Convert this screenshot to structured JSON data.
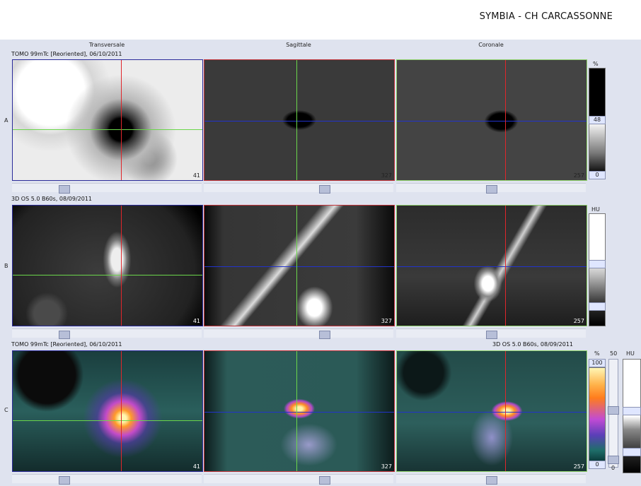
{
  "header": {
    "site": "SYMBIA - CH CARCASSONNE"
  },
  "columns": [
    "Transversale",
    "Sagittale",
    "Coronale"
  ],
  "rows": {
    "A": {
      "label": "A",
      "series": "TOMO 99mTc [Reoriented], 06/10/2011"
    },
    "B": {
      "label": "B",
      "series": "3D  OS  5.0  B60s, 08/09/2011"
    },
    "C": {
      "label": "C",
      "series_left": "TOMO 99mTc [Reoriented], 06/10/2011",
      "series_right": "3D  OS  5.0  B60s, 08/09/2011"
    }
  },
  "slices": {
    "transversale": "41",
    "sagittale": "327",
    "coronale": "257"
  },
  "scales": {
    "A": {
      "unit": "%",
      "mid": "48",
      "min": "0"
    },
    "B": {
      "unit": "HU"
    },
    "C": {
      "unit_pct": "%",
      "top_pct": "100",
      "min_pct": "0",
      "unit_mid": "50",
      "unit_hu": "HU",
      "hu_min": "0"
    }
  },
  "colors": {
    "transversale": "#2b2b9a",
    "sagittale": "#c2343a",
    "coronale": "#8fd16b",
    "crosshair_h_green": "#6bd64b",
    "crosshair_v_red": "#e0262b",
    "crosshair_h_blue": "#2233cc"
  },
  "icons": [
    "scrollbar-thumb-icon"
  ]
}
